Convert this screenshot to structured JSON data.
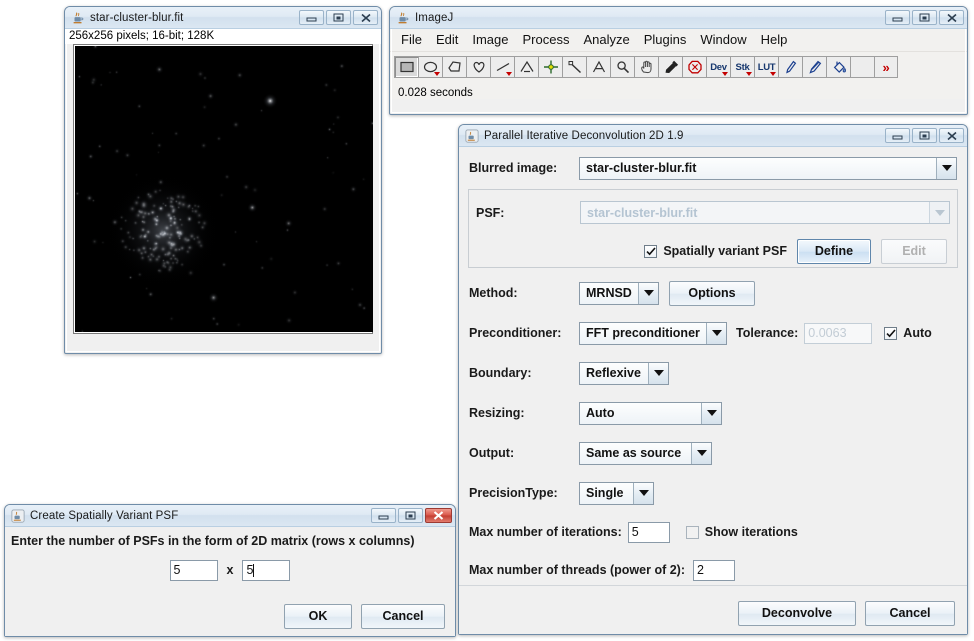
{
  "image_window": {
    "title": "star-cluster-blur.fit",
    "status": "256x256 pixels; 16-bit; 128K",
    "icon": "java-cup-icon",
    "buttons": {
      "minimize": "minimize-icon",
      "maximize": "maximize-icon",
      "close": "close-icon"
    }
  },
  "imagej": {
    "title": "ImageJ",
    "menus": [
      "File",
      "Edit",
      "Image",
      "Process",
      "Analyze",
      "Plugins",
      "Window",
      "Help"
    ],
    "tools": [
      {
        "name": "rectangle-tool",
        "selected": true,
        "dropdown": false
      },
      {
        "name": "oval-tool",
        "selected": false,
        "dropdown": true
      },
      {
        "name": "polygon-tool",
        "selected": false,
        "dropdown": false
      },
      {
        "name": "freehand-tool",
        "selected": false,
        "dropdown": false
      },
      {
        "name": "line-tool",
        "selected": false,
        "dropdown": true
      },
      {
        "name": "angle-tool",
        "selected": false,
        "dropdown": false
      },
      {
        "name": "point-tool",
        "selected": false,
        "dropdown": false
      },
      {
        "name": "wand-tool",
        "selected": false,
        "dropdown": false
      },
      {
        "name": "text-tool",
        "selected": false,
        "dropdown": false
      },
      {
        "name": "magnifier-tool",
        "selected": false,
        "dropdown": false
      },
      {
        "name": "hand-tool",
        "selected": false,
        "dropdown": false
      },
      {
        "name": "dropper-tool",
        "selected": false,
        "dropdown": false
      },
      {
        "name": "stop-tool",
        "selected": false,
        "dropdown": false
      },
      {
        "name": "dev-tool",
        "label": "Dev",
        "selected": false,
        "dropdown": true
      },
      {
        "name": "stk-tool",
        "label": "Stk",
        "selected": false,
        "dropdown": true
      },
      {
        "name": "lut-tool",
        "label": "LUT",
        "selected": false,
        "dropdown": true
      },
      {
        "name": "pencil-tool",
        "selected": false,
        "dropdown": false
      },
      {
        "name": "brush-tool",
        "selected": false,
        "dropdown": false
      },
      {
        "name": "flood-fill-tool",
        "selected": false,
        "dropdown": false
      },
      {
        "name": "blank-tool",
        "selected": false,
        "dropdown": false
      },
      {
        "name": "more-tools",
        "label": ">>",
        "selected": false,
        "dropdown": false
      }
    ],
    "status": "0.028 seconds"
  },
  "decon": {
    "title": "Parallel Iterative Deconvolution 2D 1.9",
    "blurred_image_label": "Blurred image:",
    "blurred_image_value": "star-cluster-blur.fit",
    "psf_label": "PSF:",
    "psf_value": "star-cluster-blur.fit",
    "sv_psf_label": "Spatially variant PSF",
    "sv_psf_checked": true,
    "define_label": "Define",
    "edit_label": "Edit",
    "method_label": "Method:",
    "method_value": "MRNSD",
    "options_label": "Options",
    "preconditioner_label": "Preconditioner:",
    "preconditioner_value": "FFT preconditioner",
    "tolerance_label": "Tolerance:",
    "tolerance_value": "0.0063",
    "auto_label": "Auto",
    "auto_checked": true,
    "boundary_label": "Boundary:",
    "boundary_value": "Reflexive",
    "resizing_label": "Resizing:",
    "resizing_value": "Auto",
    "output_label": "Output:",
    "output_value": "Same as source",
    "precision_label": "PrecisionType:",
    "precision_value": "Single",
    "max_iter_label": "Max number of iterations:",
    "max_iter_value": "5",
    "show_iter_label": "Show iterations",
    "show_iter_checked": false,
    "max_threads_label": "Max number of threads (power of 2):",
    "max_threads_value": "2",
    "deconvolve_label": "Deconvolve",
    "cancel_label": "Cancel"
  },
  "psf_dialog": {
    "title": "Create Spatially Variant PSF",
    "prompt": "Enter the number of PSFs in the form of 2D matrix (rows x columns)",
    "rows_value": "5",
    "times_label": "x",
    "cols_value": "5",
    "ok_label": "OK",
    "cancel_label": "Cancel"
  },
  "colors": {
    "window_bg": "#f0f0f0",
    "desktop": "#ffffff",
    "title_active": "#d2e0ee",
    "close_red": "#c23d31",
    "tool_accent": "#16376e",
    "tool_dropdown": "#c40000"
  }
}
